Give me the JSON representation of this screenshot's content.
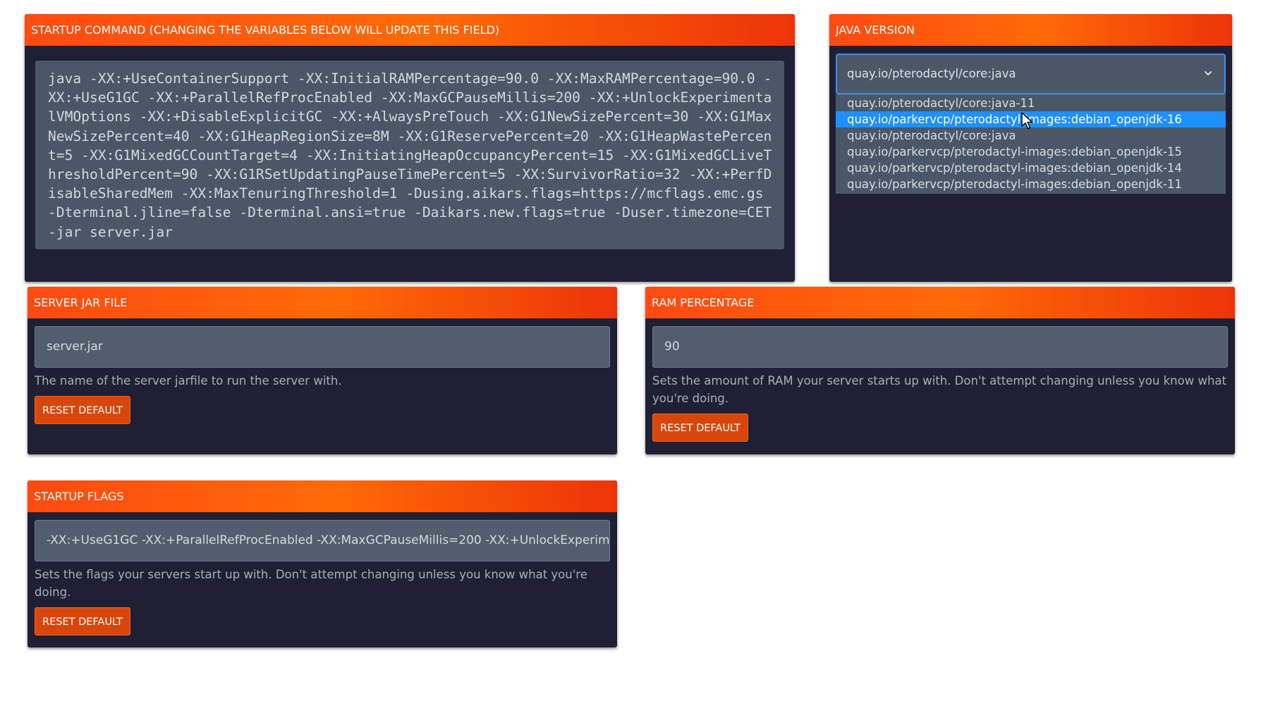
{
  "startup_command": {
    "title": "STARTUP COMMAND (CHANGING THE VARIABLES BELOW WILL UPDATE THIS FIELD)",
    "command": "java -XX:+UseContainerSupport -XX:InitialRAMPercentage=90.0 -XX:MaxRAMPercentage=90.0 -XX:+UseG1GC -XX:+ParallelRefProcEnabled -XX:MaxGCPauseMillis=200 -XX:+UnlockExperimentalVMOptions -XX:+DisableExplicitGC -XX:+AlwaysPreTouch -XX:G1NewSizePercent=30 -XX:G1MaxNewSizePercent=40 -XX:G1HeapRegionSize=8M -XX:G1ReservePercent=20 -XX:G1HeapWastePercent=5 -XX:G1MixedGCCountTarget=4 -XX:InitiatingHeapOccupancyPercent=15 -XX:G1MixedGCLiveThresholdPercent=90 -XX:G1RSetUpdatingPauseTimePercent=5 -XX:SurvivorRatio=32 -XX:+PerfDisableSharedMem -XX:MaxTenuringThreshold=1 -Dusing.aikars.flags=https://mcflags.emc.gs -Dterminal.jline=false -Dterminal.ansi=true -Daikars.new.flags=true -Duser.timezone=CET -jar server.jar"
  },
  "java_version": {
    "title": "JAVA VERSION",
    "selected": "quay.io/pterodactyl/core:java",
    "options": [
      "quay.io/pterodactyl/core:java-11",
      "quay.io/parkervcp/pterodactyl-images:debian_openjdk-16",
      "quay.io/pterodactyl/core:java",
      "quay.io/parkervcp/pterodactyl-images:debian_openjdk-15",
      "quay.io/parkervcp/pterodactyl-images:debian_openjdk-14",
      "quay.io/parkervcp/pterodactyl-images:debian_openjdk-11"
    ],
    "highlighted_index": 1
  },
  "server_jar": {
    "title": "SERVER JAR FILE",
    "value": "server.jar",
    "help": "The name of the server jarfile to run the server with.",
    "reset_label": "RESET DEFAULT"
  },
  "ram_percentage": {
    "title": "RAM PERCENTAGE",
    "value": "90",
    "help": "Sets the amount of RAM your server starts up with. Don't attempt changing unless you know what you're doing.",
    "reset_label": "RESET DEFAULT"
  },
  "startup_flags": {
    "title": "STARTUP FLAGS",
    "value": "-XX:+UseG1GC -XX:+ParallelRefProcEnabled -XX:MaxGCPauseMillis=200 -XX:+UnlockExperimentalVMOptions",
    "help": "Sets the flags your servers start up with. Don't attempt changing unless you know what you're doing.",
    "reset_label": "RESET DEFAULT"
  },
  "colors": {
    "card_bg": "#1f2034",
    "header_accent": "#ff6a06",
    "button": "#d9460c",
    "input_bg": "#525e6d",
    "select_highlight": "#1e90ff"
  },
  "icons": {
    "dropdown": "chevron-down-icon",
    "cursor": "mouse-pointer-icon"
  }
}
